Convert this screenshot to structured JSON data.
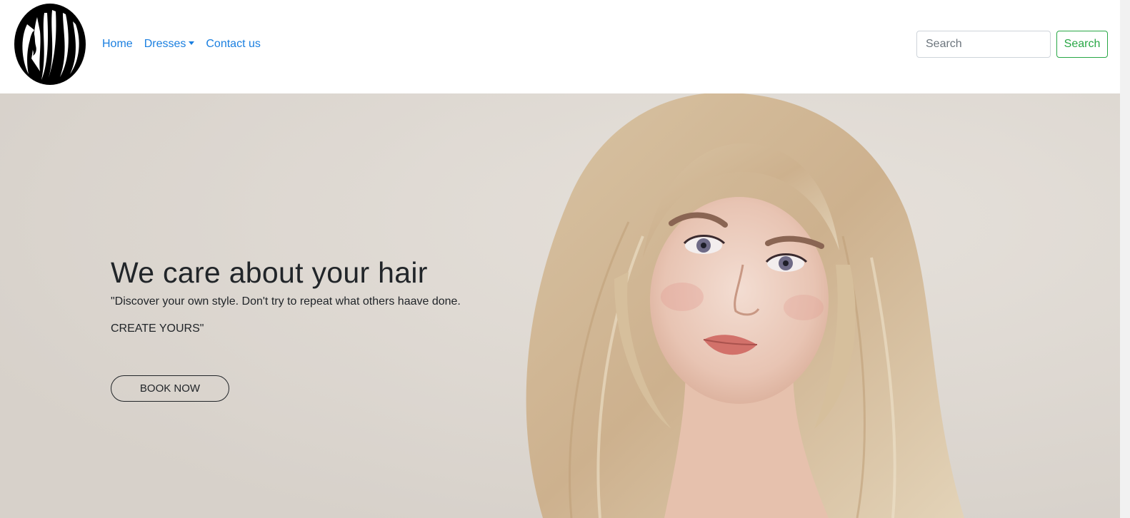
{
  "navbar": {
    "logo_icon": "woman-hair-silhouette-icon",
    "links": {
      "home": "Home",
      "dresses": "Dresses",
      "contact": "Contact us"
    },
    "search": {
      "placeholder": "Search",
      "button_label": "Search"
    }
  },
  "hero": {
    "title": "We care about your hair",
    "quote_line1": "\"Discover your own style. Don't try to repeat what others haave done.",
    "quote_line2": "CREATE YOURS\"",
    "button_label": "BOOK NOW",
    "image": "blonde-woman-portrait"
  },
  "colors": {
    "link": "#1a7fe0",
    "search_button": "#28a745",
    "hero_bg": "#ddd8d2",
    "text": "#212529"
  }
}
